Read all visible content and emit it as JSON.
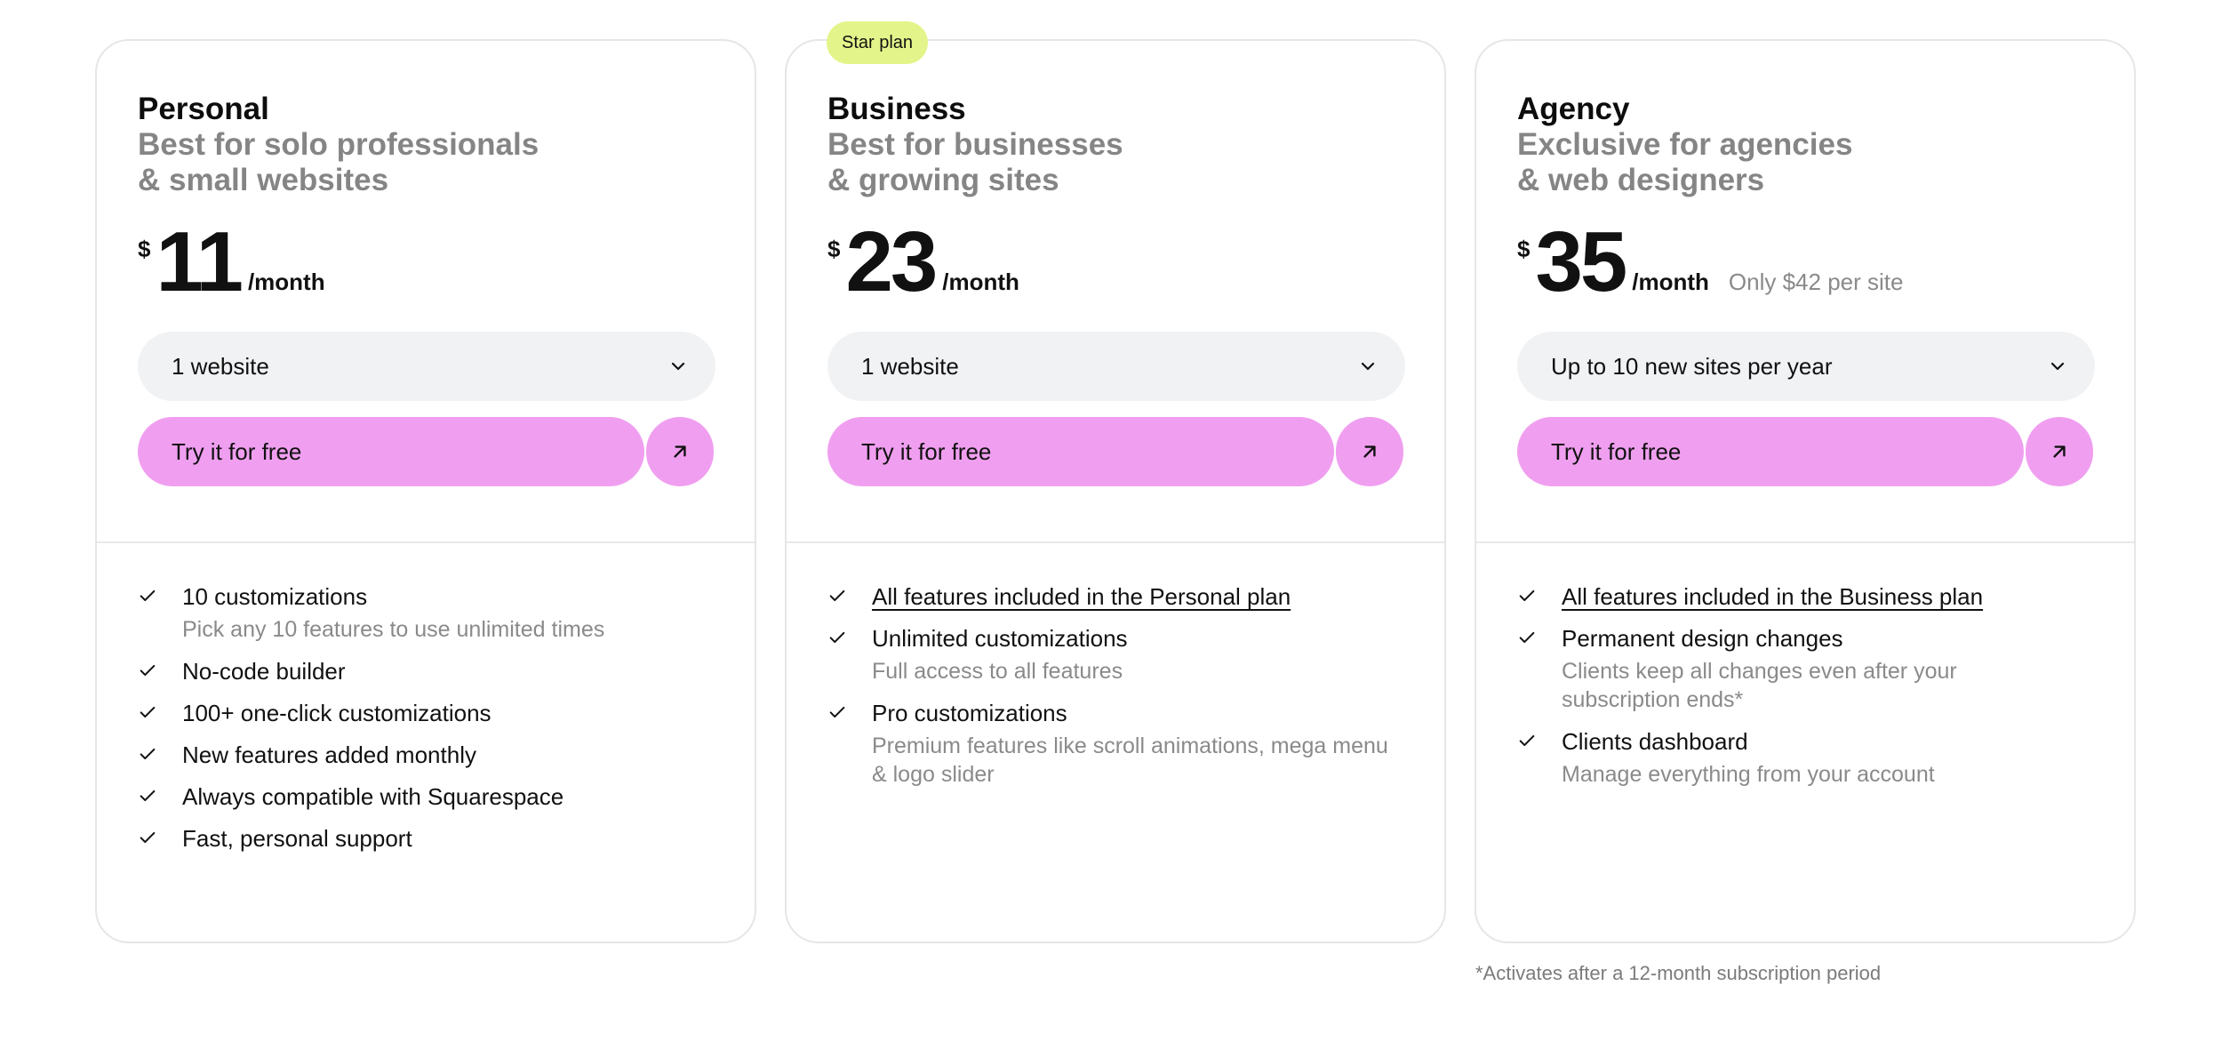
{
  "plans": [
    {
      "name": "Personal",
      "tagline_1": "Best for solo professionals",
      "tagline_2": "& small websites",
      "currency": "$",
      "price": "11",
      "period": "/month",
      "price_note": "",
      "select_value": "1 website",
      "cta_label": "Try it for free",
      "features": [
        {
          "title": "10 customizations",
          "desc": "Pick any 10 features to use unlimited times"
        },
        {
          "title": "No-code builder",
          "desc": ""
        },
        {
          "title": "100+ one-click customizations",
          "desc": ""
        },
        {
          "title": "New features added monthly",
          "desc": ""
        },
        {
          "title": "Always compatible with Squarespace",
          "desc": ""
        },
        {
          "title": "Fast, personal support",
          "desc": ""
        }
      ]
    },
    {
      "badge": "Star plan",
      "name": "Business",
      "tagline_1": "Best for businesses",
      "tagline_2": "& growing sites",
      "currency": "$",
      "price": "23",
      "period": "/month",
      "price_note": "",
      "select_value": "1 website",
      "cta_label": "Try it for free",
      "features": [
        {
          "title": "All features included in the Personal plan",
          "desc": ""
        },
        {
          "title": "Unlimited customizations",
          "desc": "Full access to all features"
        },
        {
          "title": "Pro customizations",
          "desc": "Premium features like scroll animations, mega menu & logo slider"
        }
      ]
    },
    {
      "name": "Agency",
      "tagline_1": "Exclusive for agencies",
      "tagline_2": "& web designers",
      "currency": "$",
      "price": "35",
      "period": "/month",
      "price_note": "Only $42 per site",
      "select_value": "Up to 10 new sites per year",
      "cta_label": "Try it for free",
      "features": [
        {
          "title": "All features included in the Business plan",
          "desc": ""
        },
        {
          "title": "Permanent design changes",
          "desc": "Clients keep all changes even after your subscription ends*"
        },
        {
          "title": "Clients dashboard",
          "desc": "Manage everything from your account"
        }
      ]
    }
  ],
  "footnote": "*Activates after a 12-month subscription period",
  "colors": {
    "cta": "#f09ff0",
    "badge": "#e3f58a",
    "select_bg": "#f1f2f4",
    "muted_text": "#858585"
  }
}
